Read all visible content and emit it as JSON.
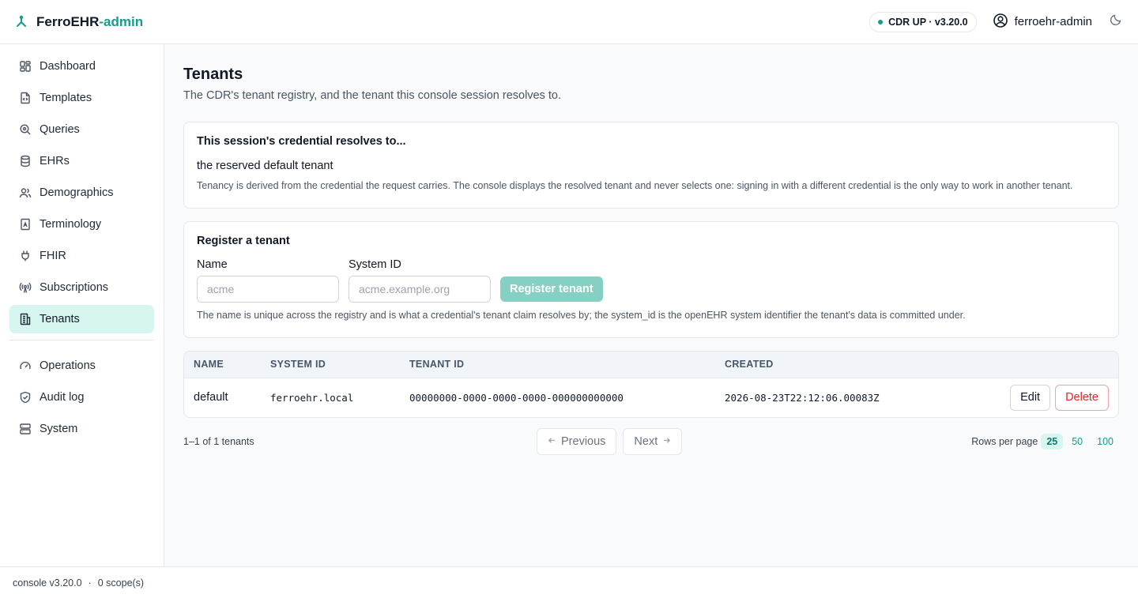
{
  "header": {
    "brand_main": "FerroEHR",
    "brand_accent": "-admin",
    "status": "CDR UP · v3.20.0",
    "user": "ferroehr-admin",
    "colors": {
      "accent": "#0f9f8a",
      "active_bg": "#d7f6ef",
      "danger": "#dc2626"
    }
  },
  "sidebar": {
    "items": [
      {
        "label": "Dashboard",
        "icon": "dashboard-icon"
      },
      {
        "label": "Templates",
        "icon": "file-code-icon"
      },
      {
        "label": "Queries",
        "icon": "search-icon"
      },
      {
        "label": "EHRs",
        "icon": "database-icon"
      },
      {
        "label": "Demographics",
        "icon": "users-icon"
      },
      {
        "label": "Terminology",
        "icon": "book-icon"
      },
      {
        "label": "FHIR",
        "icon": "plug-icon"
      },
      {
        "label": "Subscriptions",
        "icon": "radio-icon"
      },
      {
        "label": "Tenants",
        "icon": "building-icon",
        "active": true
      }
    ],
    "secondary": [
      {
        "label": "Operations",
        "icon": "gauge-icon"
      },
      {
        "label": "Audit log",
        "icon": "shield-icon"
      },
      {
        "label": "System",
        "icon": "server-icon"
      }
    ]
  },
  "page": {
    "title": "Tenants",
    "subtitle": "The CDR's tenant registry, and the tenant this console session resolves to."
  },
  "session_card": {
    "title": "This session's credential resolves to...",
    "value": "the reserved default tenant",
    "note": "Tenancy is derived from the credential the request carries. The console displays the resolved tenant and never selects one: signing in with a different credential is the only way to work in another tenant."
  },
  "register_card": {
    "title": "Register a tenant",
    "name_label": "Name",
    "name_placeholder": "acme",
    "system_id_label": "System ID",
    "system_id_placeholder": "acme.example.org",
    "submit_label": "Register tenant",
    "note": "The name is unique across the registry and is what a credential's tenant claim resolves by; the system_id is the openEHR system identifier the tenant's data is committed under."
  },
  "table": {
    "headers": [
      "NAME",
      "SYSTEM ID",
      "TENANT ID",
      "CREATED"
    ],
    "rows": [
      {
        "name": "default",
        "system_id": "ferroehr.local",
        "tenant_id": "00000000-0000-0000-0000-000000000000",
        "created": "2026-08-23T22:12:06.00083Z",
        "edit_label": "Edit",
        "delete_label": "Delete"
      }
    ]
  },
  "pager": {
    "count": "1–1 of 1 tenants",
    "prev_label": "Previous",
    "next_label": "Next",
    "rows_label": "Rows per page",
    "options": [
      "25",
      "50",
      "100"
    ],
    "selected": "25"
  },
  "footer": {
    "version": "console v3.20.0",
    "sep": "·",
    "scopes": "0 scope(s)"
  }
}
